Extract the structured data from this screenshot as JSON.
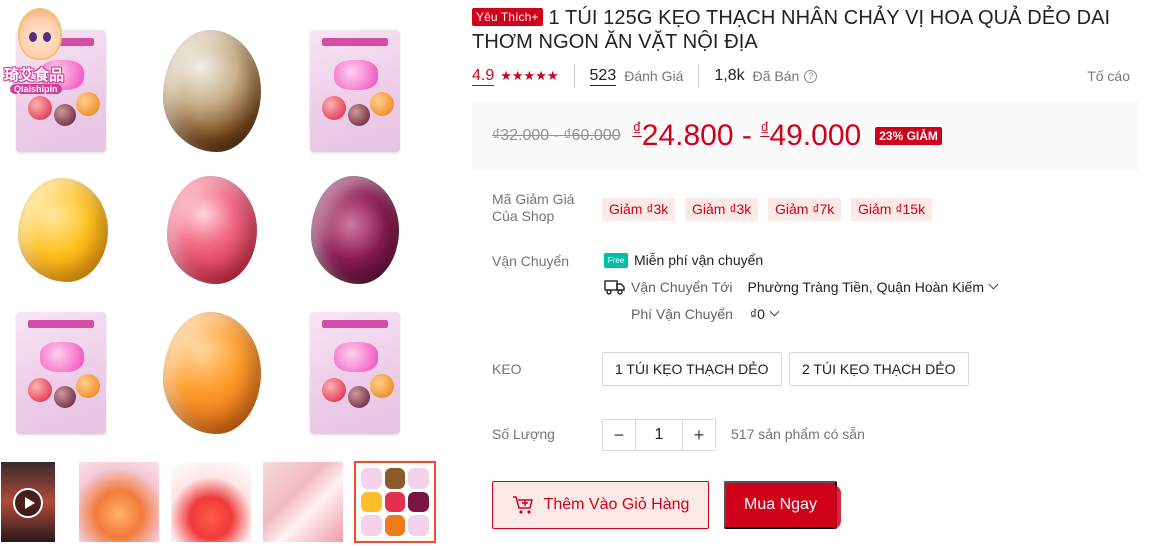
{
  "gallery": {
    "logo_text": "琦艾食品",
    "logo_sub": "Qiaishipin",
    "thumbnails": [
      {
        "name": "video-thumbnail",
        "kind": "video"
      },
      {
        "name": "gummy-bowl-thumbnail",
        "kind": "image"
      },
      {
        "name": "gummy-strawberry-thumbnail",
        "kind": "image"
      },
      {
        "name": "gummy-pack-thumbnail",
        "kind": "image"
      },
      {
        "name": "gummy-grid-thumbnail",
        "kind": "image",
        "active": true
      }
    ]
  },
  "product": {
    "badge": "Yêu Thích+",
    "title": "1 TÚI 125G KẸO THẠCH NHÂN CHẢY VỊ HOA QUẢ DẺO DAI THƠM NGON ĂN VẶT NỘI ĐỊA",
    "rating": "4.9",
    "stars": "★★★★★",
    "review_count": "523",
    "review_label": "Đánh Giá",
    "sold_count": "1,8k",
    "sold_label": "Đã Bán",
    "help_icon": "?",
    "report_label": "Tố cáo"
  },
  "price": {
    "old": "₫32.000 - ₫60.000",
    "currency": "₫",
    "low": "24.800",
    "dash": " - ",
    "high": "49.000",
    "discount": "23% GIẢM"
  },
  "vouchers": {
    "label": "Mã Giảm Giá Của Shop",
    "items": [
      "Giảm ₫3k",
      "Giảm ₫3k",
      "Giảm ₫7k",
      "Giảm ₫15k"
    ]
  },
  "shipping": {
    "label": "Vận Chuyển",
    "free_badge": "Free",
    "free_text": "Miễn phí vận chuyển",
    "to_label": "Vận Chuyển Tới",
    "to_value": "Phường Tràng Tiền, Quận Hoàn Kiếm",
    "fee_label": "Phí Vận Chuyển",
    "fee_value": "₫0"
  },
  "variant": {
    "label": "KEO",
    "options": [
      "1 TÚI KẸO THẠCH DẺO",
      "2 TÚI KẸO THẠCH DẺO"
    ]
  },
  "quantity": {
    "label": "Số Lượng",
    "minus": "−",
    "value": "1",
    "plus": "+",
    "stock": "517 sản phẩm có sẵn"
  },
  "actions": {
    "add_to_cart": "Thêm Vào Giỏ Hàng",
    "buy_now": "Mua Ngay"
  },
  "colors": {
    "accent": "#d0011b",
    "voucher_bg": "#fbe9e6",
    "price_bg": "#fafafa",
    "free_ship": "#00bfa5"
  }
}
